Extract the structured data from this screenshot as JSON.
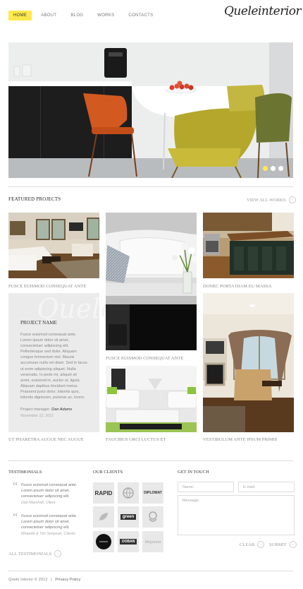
{
  "nav": {
    "items": [
      "HOME",
      "ABOUT",
      "BLOG",
      "WORKS",
      "CONTACTS"
    ]
  },
  "logo": {
    "text": "Queleinterior"
  },
  "featured": {
    "title": "FEATURED PROJECTS",
    "view_all": "VIEW ALL WORKS"
  },
  "tiles": {
    "cap1": "FUSCE EUISMOD CONSEQUAT ANTE",
    "cap2": "DONEC PORTA DIAM EU MASSA",
    "cap3": "FUSCE EUISMOD CONSEQUAT ANTE",
    "cap4": "UT PHARETRA AUGUE NEC AUGUE",
    "cap5": "FAUCIBUS ORCI LUCTUS ET",
    "cap6": "VESTIBULUM ANTE IPSUM PRIMIS"
  },
  "project": {
    "watermark": "Quele",
    "heading": "PROJECT NAME",
    "body": "Fusce euismod consequat ante. Lorem ipsum dolor sit amet, consectetuer adipiscing elit. Pellentesque sed dolor. Aliquam congue fermentum nisl. Mauris accumsan nulla vel diam. Sed in lacus ut enim adipiscing aliquet. Nulla venenatis. In pede mi, aliquet sit amet, euismod in, auctor ut, ligula. Aliquam dapibus tincidunt metus. Praesent justo dolor, lobortis quis, lobortis dignissim, pulvinar ac, lorem.",
    "manager_label": "Project manager:",
    "manager_name": "Dan Adams",
    "date": "November 12, 2011"
  },
  "testimonials": {
    "title": "TESTIMONIALS",
    "items": [
      {
        "text": "Fusce euismod consequat ante. Lorem ipsum dolor sit amet, consectetuer adipiscing elit.",
        "author": "Dan Marshall, Client"
      },
      {
        "text": "Fusce euismod consequat ante. Lorem ipsum dolor sit amet, consectetuer adipiscing elit.",
        "author": "Miranda & Tim Simpson, Clients"
      }
    ],
    "all_label": "ALL TESTIMONIALS"
  },
  "clients": {
    "title": "OUR CLIENTS",
    "logos": [
      "RAPID",
      "",
      "DIPLOMAT",
      "",
      "green",
      "",
      "",
      "OOBAN",
      "Majenna"
    ]
  },
  "contact": {
    "title": "GET IN TOUCH",
    "name_placeholder": "Name:",
    "email_placeholder": "E-mail:",
    "message_placeholder": "Message:",
    "clear": "CLEAR",
    "submit": "SUBMIT"
  },
  "footer": {
    "copyright": "Quele Interior © 2012",
    "separator": "|",
    "privacy": "Privacy Policy"
  },
  "colors": {
    "accent": "#ffe94d",
    "panel": "#ebebeb"
  }
}
